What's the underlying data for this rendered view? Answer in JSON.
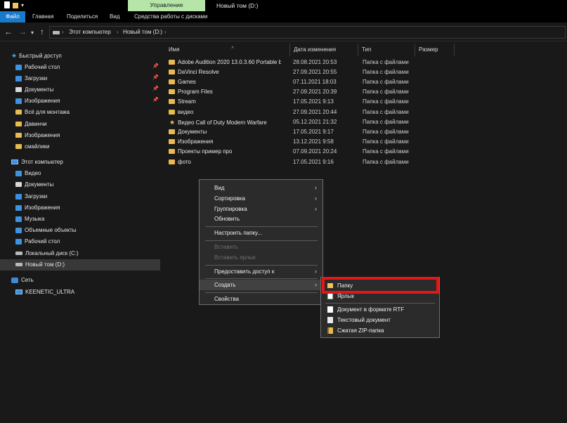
{
  "titlebar": {
    "manage_tab": "Управление",
    "window_title": "Новый том (D:)"
  },
  "ribbon_tabs": [
    "Файл",
    "Главная",
    "Поделиться",
    "Вид",
    "Средства работы с дисками"
  ],
  "address": {
    "crumbs": [
      "Этот компьютер",
      "Новый том (D:)"
    ]
  },
  "sidebar": {
    "quick_access": "Быстрый доступ",
    "quick_items": [
      "Рабочий стол",
      "Загрузки",
      "Документы",
      "Изображения",
      "Всё для монтажа",
      "Давинчи",
      "Изображения",
      "смайлики"
    ],
    "this_pc": "Этот компьютер",
    "pc_items": [
      "Видео",
      "Документы",
      "Загрузки",
      "Изображения",
      "Музыка",
      "Объемные объекты",
      "Рабочий стол",
      "Локальный диск (C:)",
      "Новый том (D:)"
    ],
    "network": "Сеть",
    "network_items": [
      "KEENETIC_ULTRA"
    ]
  },
  "columns": {
    "name": "Имя",
    "date": "Дата изменения",
    "type": "Тип",
    "size": "Размер"
  },
  "files": [
    {
      "name": "Adobe Audition 2020 13.0.3.60 Portable b...",
      "date": "28.08.2021 20:53",
      "type": "Папка с файлами"
    },
    {
      "name": "DaVinci Resolve",
      "date": "27.09.2021 20:55",
      "type": "Папка с файлами"
    },
    {
      "name": "Games",
      "date": "07.11.2021 18:03",
      "type": "Папка с файлами"
    },
    {
      "name": "Program Files",
      "date": "27.09.2021 20:39",
      "type": "Папка с файлами"
    },
    {
      "name": "Stream",
      "date": "17.05.2021 9:13",
      "type": "Папка с файлами"
    },
    {
      "name": "видео",
      "date": "27.09.2021 20:44",
      "type": "Папка с файлами"
    },
    {
      "name": "Видео Call of Duty Modern Warfare",
      "date": "05.12.2021 21:32",
      "type": "Папка с файлами"
    },
    {
      "name": "Документы",
      "date": "17.05.2021 9:17",
      "type": "Папка с файлами"
    },
    {
      "name": "Изображения",
      "date": "13.12.2021 9:58",
      "type": "Папка с файлами"
    },
    {
      "name": "Проекты пример про",
      "date": "07.09.2021 20:24",
      "type": "Папка с файлами"
    },
    {
      "name": "фото",
      "date": "17.05.2021 9:16",
      "type": "Папка с файлами"
    }
  ],
  "context_menu": {
    "view": "Вид",
    "sort": "Сортировка",
    "group": "Группировка",
    "refresh": "Обновить",
    "customize": "Настроить папку...",
    "paste": "Вставить",
    "paste_shortcut": "Вставить ярлык",
    "share": "Предоставить доступ к",
    "create": "Создать",
    "properties": "Свойства"
  },
  "create_submenu": {
    "folder": "Папку",
    "shortcut": "Ярлык",
    "rtf": "Документ в формате RTF",
    "txt": "Текстовый документ",
    "zip": "Сжатая ZIP-папка"
  },
  "colors": {
    "file_tab": "#1979ca",
    "manage_tab": "#b5e6a8",
    "folder": "#e8bb52",
    "highlight": "#e01818"
  }
}
